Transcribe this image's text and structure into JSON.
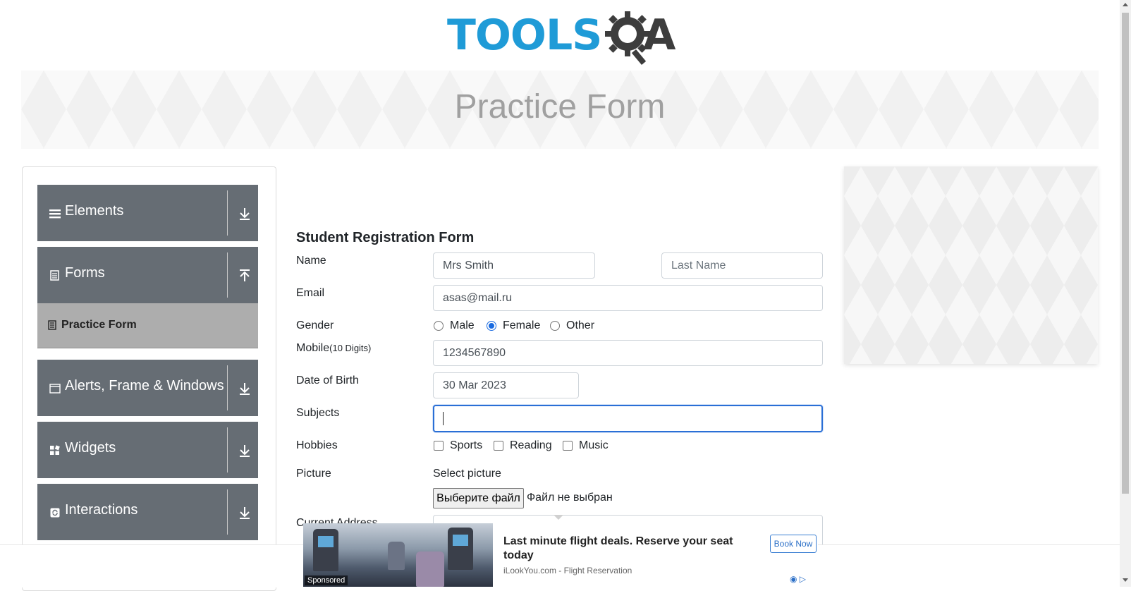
{
  "header": {
    "logo_text_left": "TOOLS",
    "logo_text_right": "A",
    "logo_icon": "gear-magnifier-icon"
  },
  "banner": {
    "title": "Practice Form"
  },
  "sidebar": {
    "groups": [
      {
        "label": "Elements",
        "icon": "hamburger-icon",
        "state": "collapsed"
      },
      {
        "label": "Forms",
        "icon": "document-icon",
        "state": "expanded"
      },
      {
        "label": "Alerts, Frame & Windows",
        "icon": "window-icon",
        "state": "collapsed"
      },
      {
        "label": "Widgets",
        "icon": "widgets-icon",
        "state": "collapsed"
      },
      {
        "label": "Interactions",
        "icon": "interactions-icon",
        "state": "collapsed"
      }
    ],
    "active_item": {
      "label": "Practice Form",
      "icon": "form-icon"
    }
  },
  "form": {
    "title": "Student Registration Form",
    "name_label": "Name",
    "first_name_value": "Mrs Smith",
    "last_name_placeholder": "Last Name",
    "email_label": "Email",
    "email_value": "asas@mail.ru",
    "gender_label": "Gender",
    "gender_options": [
      "Male",
      "Female",
      "Other"
    ],
    "gender_selected": "Female",
    "mobile_label": "Mobile",
    "mobile_hint": "(10 Digits)",
    "mobile_value": "1234567890",
    "dob_label": "Date of Birth",
    "dob_value": "30 Mar 2023",
    "subjects_label": "Subjects",
    "subjects_value": "",
    "hobbies_label": "Hobbies",
    "hobbies_options": [
      "Sports",
      "Reading",
      "Music"
    ],
    "picture_label": "Picture",
    "picture_hint": "Select picture",
    "file_button": "Выберите файл",
    "file_status": "Файл не выбран",
    "address_label": "Current Address"
  },
  "ad": {
    "sponsored": "Sponsored",
    "headline": "Last minute flight deals. Reserve your seat today",
    "source": "iLookYou.com - Flight Reservation",
    "cta": "Book Now"
  },
  "colors": {
    "menu_bg": "#666d74",
    "active_item_bg": "#adadad",
    "logo_blue": "#1f9bd7",
    "focus_blue": "#2a6fd6"
  }
}
